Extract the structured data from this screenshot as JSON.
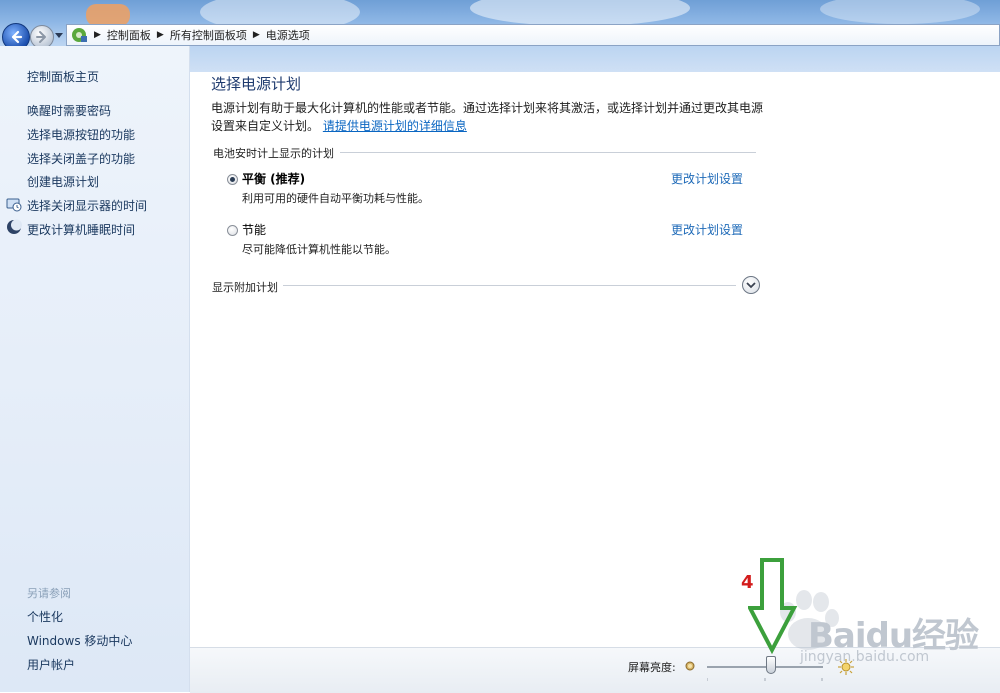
{
  "breadcrumb": [
    "控制面板",
    "所有控制面板项",
    "电源选项"
  ],
  "sidebar": {
    "home": "控制面板主页",
    "links": [
      {
        "label": "唤醒时需要密码",
        "icon": null
      },
      {
        "label": "选择电源按钮的功能",
        "icon": null
      },
      {
        "label": "选择关闭盖子的功能",
        "icon": null
      },
      {
        "label": "创建电源计划",
        "icon": null
      },
      {
        "label": "选择关闭显示器的时间",
        "icon": "monitor-icon"
      },
      {
        "label": "更改计算机睡眠时间",
        "icon": "moon-icon"
      }
    ],
    "see_also": "另请参阅",
    "see_also_links": [
      "个性化",
      "Windows 移动中心",
      "用户帐户"
    ]
  },
  "main": {
    "title": "选择电源计划",
    "description": "电源计划有助于最大化计算机的性能或者节能。通过选择计划来将其激活，或选择计划并通过更改其电源设置来自定义计划。",
    "info_link": "请提供电源计划的详细信息",
    "group_header": "电池安时计上显示的计划",
    "plans": [
      {
        "name": "平衡 (推荐)",
        "desc": "利用可用的硬件自动平衡功耗与性能。",
        "selected": true,
        "link": "更改计划设置"
      },
      {
        "name": "节能",
        "desc": "尽可能降低计算机性能以节能。",
        "selected": false,
        "link": "更改计划设置"
      }
    ],
    "show_more": "显示附加计划"
  },
  "brightness": {
    "label": "屏幕亮度:",
    "level_fraction": 0.55
  },
  "annotation": {
    "number": "4"
  },
  "watermark": {
    "text": "Baidu经验",
    "subtext": "jingyan.baidu.com"
  },
  "colors": {
    "link": "#1e6ab8",
    "title": "#1e3a6e",
    "annotation": "#d31c1c",
    "arrow": "#3ca03c"
  }
}
